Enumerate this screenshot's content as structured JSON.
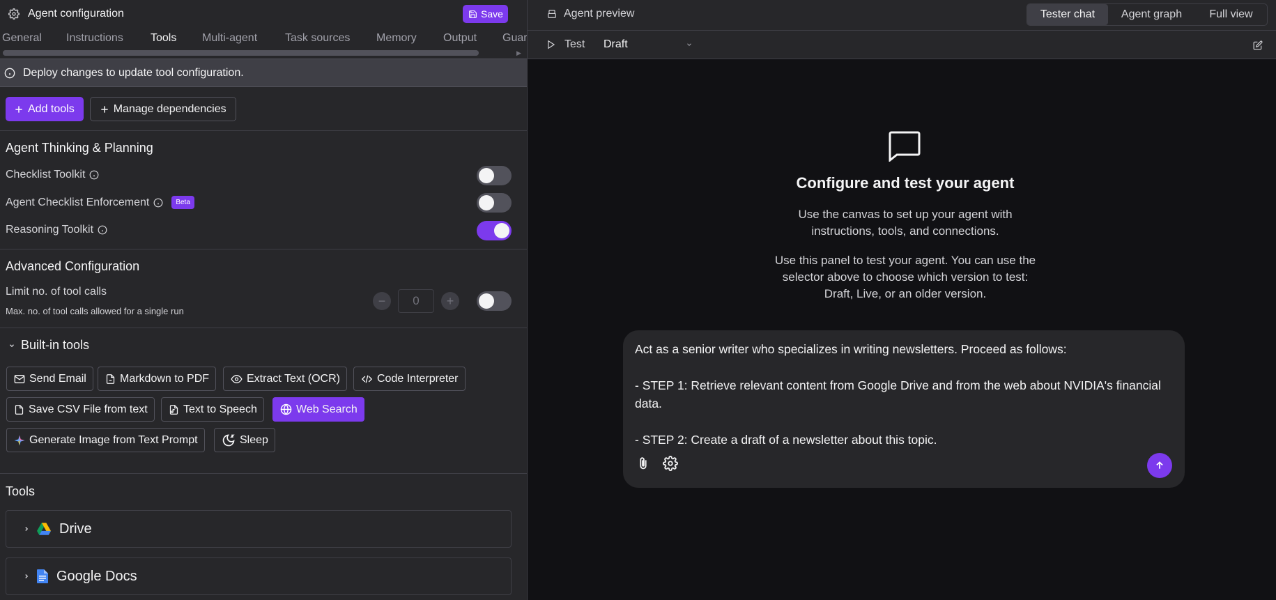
{
  "left": {
    "title": "Agent configuration",
    "save_label": "Save",
    "tabs": [
      "General",
      "Instructions",
      "Tools",
      "Multi-agent",
      "Task sources",
      "Memory",
      "Output",
      "Guar"
    ],
    "active_tab": "Tools",
    "banner": "Deploy changes to update tool configuration.",
    "add_tools_label": "Add tools",
    "manage_deps_label": "Manage dependencies",
    "thinking": {
      "title": "Agent Thinking & Planning",
      "rows": [
        {
          "label": "Checklist Toolkit",
          "enabled": false
        },
        {
          "label": "Agent Checklist Enforcement",
          "badge": "Beta",
          "enabled": false
        },
        {
          "label": "Reasoning Toolkit",
          "enabled": true
        }
      ]
    },
    "advanced": {
      "title": "Advanced Configuration",
      "limit_label": "Limit no. of tool calls",
      "limit_note": "Max. no. of tool calls allowed for a single run",
      "limit_value": "0",
      "limit_enabled": false
    },
    "builtin": {
      "title": "Built-in tools",
      "chips": [
        {
          "label": "Send Email",
          "icon": "mail-icon",
          "selected": false
        },
        {
          "label": "Markdown to PDF",
          "icon": "file-pdf-icon",
          "selected": false
        },
        {
          "label": "Extract Text (OCR)",
          "icon": "eye-icon",
          "selected": false
        },
        {
          "label": "Code Interpreter",
          "icon": "code-icon",
          "selected": false
        },
        {
          "label": "Save CSV File from text",
          "icon": "file-icon",
          "selected": false
        },
        {
          "label": "Text to Speech",
          "icon": "file-audio-icon",
          "selected": false
        },
        {
          "label": "Web Search",
          "icon": "globe-icon",
          "selected": true
        },
        {
          "label": "Generate Image from Text Prompt",
          "icon": "sparkle-icon",
          "selected": false
        },
        {
          "label": "Sleep",
          "icon": "moon-icon",
          "selected": false
        }
      ]
    },
    "tools": {
      "title": "Tools",
      "items": [
        {
          "label": "Drive",
          "icon": "google-drive-icon"
        },
        {
          "label": "Google Docs",
          "icon": "google-docs-icon"
        }
      ]
    }
  },
  "right": {
    "title": "Agent preview",
    "views": [
      "Tester chat",
      "Agent graph",
      "Full view"
    ],
    "active_view": "Tester chat",
    "test_label": "Test",
    "version_selected": "Draft",
    "empty": {
      "title": "Configure and test your agent",
      "p1_line1": "Use the canvas to set up your agent with",
      "p1_line2": "instructions, tools, and connections.",
      "p2_line1": "Use this panel to test your agent. You can use the",
      "p2_line2": "selector above to choose which version to test:",
      "p2_line3": "Draft, Live, or an older version."
    },
    "composer_text": "Act as a senior writer who specializes in writing newsletters. Proceed as follows:\n\n- STEP 1: Retrieve relevant content from Google Drive and from the web about NVIDIA's financial data.\n\n- STEP 2: Create a draft of a newsletter about this topic."
  },
  "colors": {
    "accent": "#7c3aed",
    "panel": "#27272a",
    "canvas": "#111114"
  }
}
